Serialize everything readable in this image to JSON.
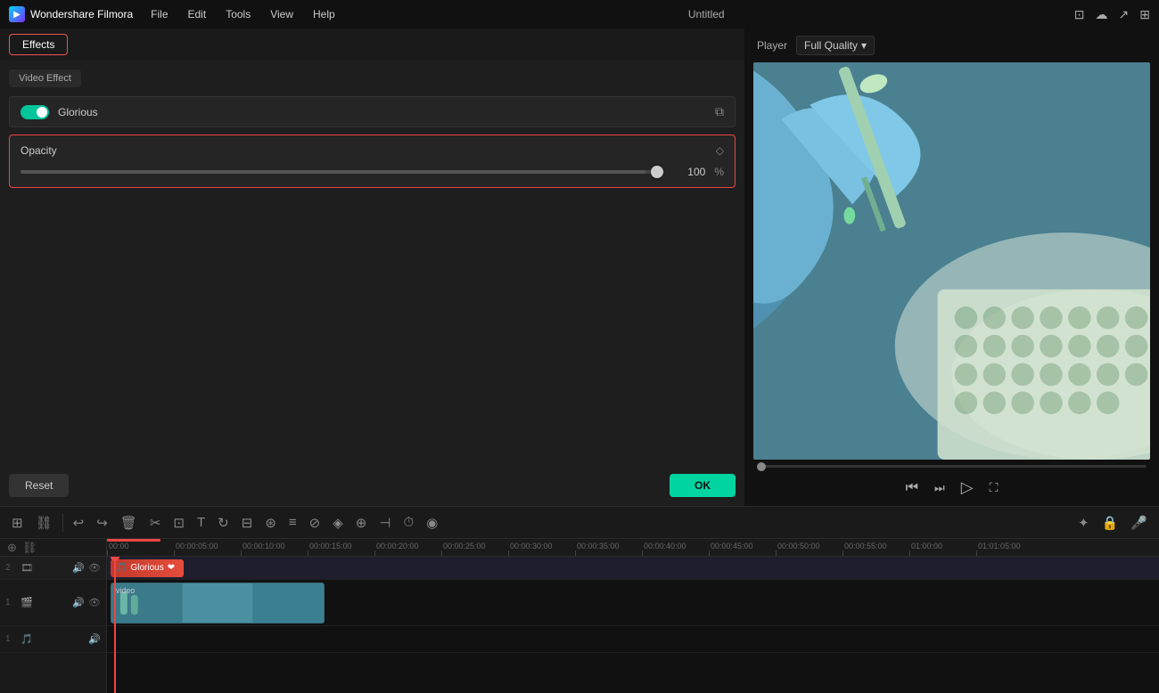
{
  "app": {
    "name": "Wondershare Filmora",
    "title": "Untitled"
  },
  "menu": {
    "items": [
      "File",
      "Edit",
      "Tools",
      "View",
      "Help"
    ]
  },
  "header_icons": [
    "monitor-icon",
    "cloud-icon",
    "settings-icon",
    "grid-icon"
  ],
  "left_panel": {
    "active_tab": "Effects",
    "inactive_tab": "Video Effect",
    "effect_name": "Glorious",
    "opacity_label": "Opacity",
    "opacity_value": "100",
    "opacity_unit": "%",
    "reset_label": "Reset",
    "ok_label": "OK"
  },
  "player": {
    "label": "Player",
    "quality_label": "Full Quality"
  },
  "timeline": {
    "toolbar_icons": [
      "layers",
      "link",
      "undo",
      "redo",
      "trash",
      "scissors",
      "crop",
      "text",
      "rotate",
      "transform",
      "adjust",
      "audio",
      "split",
      "lock",
      "filter",
      "motion",
      "trim",
      "speed",
      "voice"
    ],
    "right_icons": [
      "settings",
      "lock",
      "mic"
    ],
    "rulers": [
      "00:00",
      "00:00:05:00",
      "00:00:10:00",
      "00:00:15:00",
      "00:00:20:00",
      "00:00:25:00",
      "00:00:30:00",
      "00:00:35:00",
      "00:00:40:00",
      "00:00:45:00",
      "00:00:50:00",
      "00:00:55:00",
      "01:00:00",
      "01:01:05:00"
    ],
    "tracks": [
      {
        "type": "fx",
        "num": "2",
        "label": "Glorious"
      },
      {
        "type": "video",
        "num": "1",
        "label": "video"
      },
      {
        "type": "audio",
        "num": "1",
        "label": ""
      }
    ]
  }
}
